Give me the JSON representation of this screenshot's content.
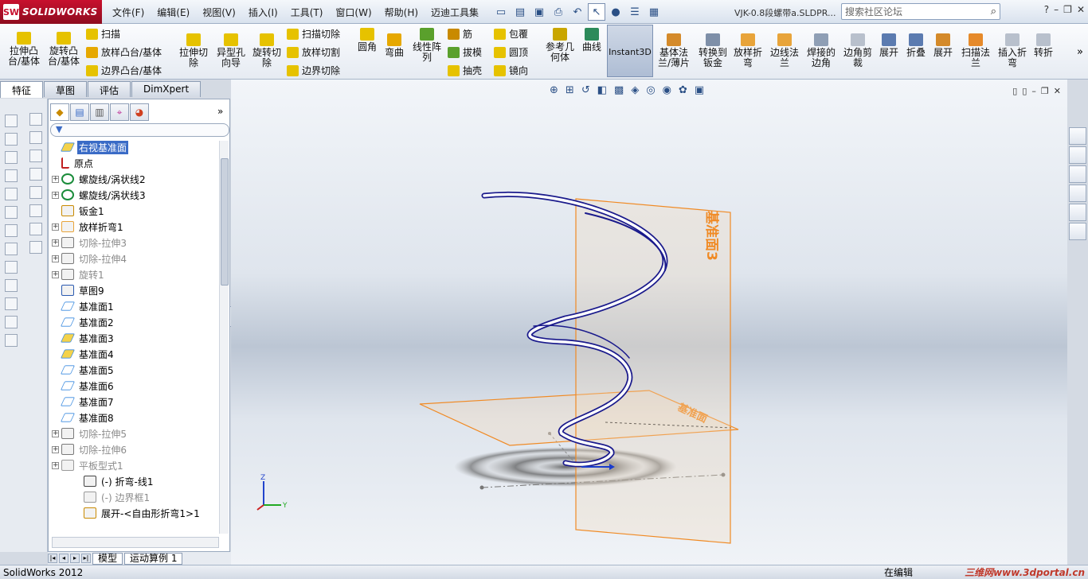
{
  "app": {
    "name": "SOLIDWORKS",
    "document_title": "VJK-0.8段螺带a.SLDPR..."
  },
  "menu": [
    "文件(F)",
    "编辑(E)",
    "视图(V)",
    "插入(I)",
    "工具(T)",
    "窗口(W)",
    "帮助(H)",
    "迈迪工具集"
  ],
  "search": {
    "placeholder": "搜索社区论坛"
  },
  "window_buttons": [
    "?",
    "–",
    "❐",
    "✕"
  ],
  "ribbon": {
    "big": [
      {
        "label": "拉伸凸\n台/基体",
        "icon": "extruded-boss-icon"
      },
      {
        "label": "旋转凸\n台/基体",
        "icon": "revolved-boss-icon"
      },
      {
        "label": "拉伸切\n除",
        "icon": "extruded-cut-icon"
      },
      {
        "label": "异型孔\n向导",
        "icon": "hole-wizard-icon"
      },
      {
        "label": "旋转切\n除",
        "icon": "revolved-cut-icon"
      },
      {
        "label": "圆角",
        "icon": "fillet-icon"
      },
      {
        "label": "弯曲",
        "icon": "flex-icon"
      },
      {
        "label": "线性阵\n列",
        "icon": "linear-pattern-icon"
      },
      {
        "label": "参考几\n何体",
        "icon": "reference-geometry-icon"
      },
      {
        "label": "曲线",
        "icon": "curves-icon"
      },
      {
        "label": "基体法\n兰/薄片",
        "icon": "base-flange-icon"
      },
      {
        "label": "转换到\n钣金",
        "icon": "convert-sheetmetal-icon"
      },
      {
        "label": "放样折\n弯",
        "icon": "lofted-bend-icon"
      },
      {
        "label": "边线法\n兰",
        "icon": "edge-flange-icon"
      },
      {
        "label": "焊接的\n边角",
        "icon": "welded-corner-icon"
      },
      {
        "label": "边角剪\n裁",
        "icon": "corner-trim-icon"
      },
      {
        "label": "展开",
        "icon": "unfold-icon"
      },
      {
        "label": "折叠",
        "icon": "fold-icon"
      },
      {
        "label": "展开",
        "icon": "flatten-icon"
      },
      {
        "label": "扫描法\n兰",
        "icon": "swept-flange-icon"
      },
      {
        "label": "插入折\n弯",
        "icon": "insert-bends-icon"
      },
      {
        "label": "转折",
        "icon": "jog-icon"
      }
    ],
    "small": [
      {
        "label": "扫描",
        "icon": "sweep-icon"
      },
      {
        "label": "放样凸台/基体",
        "icon": "lofted-boss-icon"
      },
      {
        "label": "边界凸台/基体",
        "icon": "boundary-boss-icon"
      },
      {
        "label": "扫描切除",
        "icon": "swept-cut-icon"
      },
      {
        "label": "放样切割",
        "icon": "lofted-cut-icon"
      },
      {
        "label": "边界切除",
        "icon": "boundary-cut-icon"
      },
      {
        "label": "筋",
        "icon": "rib-icon"
      },
      {
        "label": "拔模",
        "icon": "draft-icon"
      },
      {
        "label": "抽壳",
        "icon": "shell-icon"
      },
      {
        "label": "包覆",
        "icon": "wrap-icon"
      },
      {
        "label": "圆顶",
        "icon": "dome-icon"
      },
      {
        "label": "镜向",
        "icon": "mirror-icon"
      }
    ],
    "instant3d": "Instant3D"
  },
  "cm_tabs": [
    "特征",
    "草图",
    "评估",
    "DimXpert"
  ],
  "tree": [
    {
      "label": "右视基准面",
      "exp": false,
      "icon": "plane-icon",
      "selected": true
    },
    {
      "label": "原点",
      "exp": false,
      "icon": "origin-icon"
    },
    {
      "label": "螺旋线/涡状线2",
      "exp": true,
      "icon": "helix-icon"
    },
    {
      "label": "螺旋线/涡状线3",
      "exp": true,
      "icon": "helix-icon"
    },
    {
      "label": "钣金1",
      "exp": false,
      "icon": "sheetmetal-icon"
    },
    {
      "label": "放样折弯1",
      "exp": true,
      "icon": "lofted-bend-icon"
    },
    {
      "label": "切除-拉伸3",
      "exp": true,
      "icon": "cut-extrude-icon",
      "gray": true
    },
    {
      "label": "切除-拉伸4",
      "exp": true,
      "icon": "cut-extrude-icon",
      "gray": true
    },
    {
      "label": "旋转1",
      "exp": true,
      "icon": "revolve-icon",
      "gray": true
    },
    {
      "label": "草图9",
      "exp": false,
      "icon": "sketch-icon"
    },
    {
      "label": "基准面1",
      "exp": false,
      "icon": "plane-icon"
    },
    {
      "label": "基准面2",
      "exp": false,
      "icon": "plane-icon"
    },
    {
      "label": "基准面3",
      "exp": false,
      "icon": "plane-icon"
    },
    {
      "label": "基准面4",
      "exp": false,
      "icon": "plane-icon"
    },
    {
      "label": "基准面5",
      "exp": false,
      "icon": "plane-icon"
    },
    {
      "label": "基准面6",
      "exp": false,
      "icon": "plane-icon"
    },
    {
      "label": "基准面7",
      "exp": false,
      "icon": "plane-icon"
    },
    {
      "label": "基准面8",
      "exp": false,
      "icon": "plane-icon"
    },
    {
      "label": "切除-拉伸5",
      "exp": true,
      "icon": "cut-extrude-icon",
      "gray": true
    },
    {
      "label": "切除-拉伸6",
      "exp": true,
      "icon": "cut-extrude-icon",
      "gray": true
    },
    {
      "label": "平板型式1",
      "exp": true,
      "icon": "flat-pattern-icon",
      "gray": true
    },
    {
      "label": "(-) 折弯-线1",
      "exp": false,
      "icon": "bend-line-icon",
      "child": true
    },
    {
      "label": "(-) 边界框1",
      "exp": false,
      "icon": "bounding-box-icon",
      "child": true,
      "gray": true
    },
    {
      "label": "展开-<自由形折弯1>1",
      "exp": false,
      "icon": "unfold-feature-icon",
      "child": true
    }
  ],
  "bottom_tabs": [
    "模型",
    "运动算例 1"
  ],
  "viewport": {
    "plane3_label": "基准面3",
    "plane_label": "基准面",
    "axis_z": "Z",
    "axis_y": "Y"
  },
  "status": {
    "app": "SolidWorks 2012",
    "mode": "在编辑",
    "watermark": "三维网www.3dportal.cn"
  },
  "colors": {
    "accent": "#3a6bc6",
    "brand": "#c8102e",
    "helix": "#1a1a8c",
    "plane": "#f08a24"
  }
}
